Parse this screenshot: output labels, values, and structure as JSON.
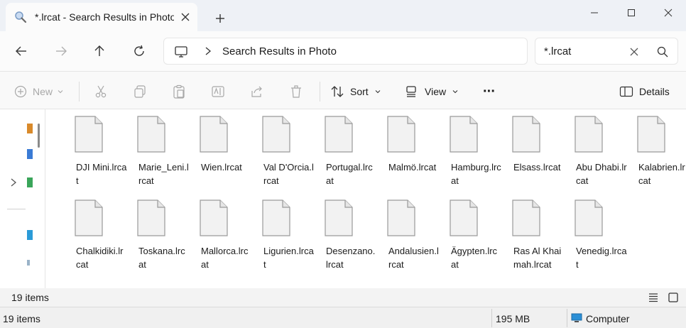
{
  "tab": {
    "title": "*.lrcat - Search Results in Photo"
  },
  "address": {
    "location": "Search Results in Photo"
  },
  "search": {
    "value": "*.lrcat"
  },
  "toolbar": {
    "new_label": "New",
    "sort_label": "Sort",
    "view_label": "View",
    "more_label": "···",
    "details_label": "Details"
  },
  "files": [
    {
      "name": "DJI Mini.lrcat"
    },
    {
      "name": "Marie_Leni.lrcat"
    },
    {
      "name": "Wien.lrcat"
    },
    {
      "name": "Val D'Orcia.lrcat"
    },
    {
      "name": "Portugal.lrcat"
    },
    {
      "name": "Malmö.lrcat"
    },
    {
      "name": "Hamburg.lrcat"
    },
    {
      "name": "Elsass.lrcat"
    },
    {
      "name": "Abu Dhabi.lrcat"
    },
    {
      "name": "Kalabrien.lrcat"
    },
    {
      "name": "Chalkidiki.lrcat"
    },
    {
      "name": "Toskana.lrcat"
    },
    {
      "name": "Mallorca.lrcat"
    },
    {
      "name": "Ligurien.lrcat"
    },
    {
      "name": "Desenzano.lrcat"
    },
    {
      "name": "Andalusien.lrcat"
    },
    {
      "name": "Ägypten.lrcat"
    },
    {
      "name": "Ras Al Khaimah.lrcat"
    },
    {
      "name": "Venedig.lrcat"
    }
  ],
  "items_count": "19 items",
  "status": {
    "items": "19 items",
    "size": "195 MB",
    "location": "Computer"
  },
  "colors": {
    "accent": "#0067c0",
    "titlebar": "#eef1f6",
    "file_icon_fill": "#f2f2f2",
    "file_icon_stroke": "#9a9a9a"
  }
}
